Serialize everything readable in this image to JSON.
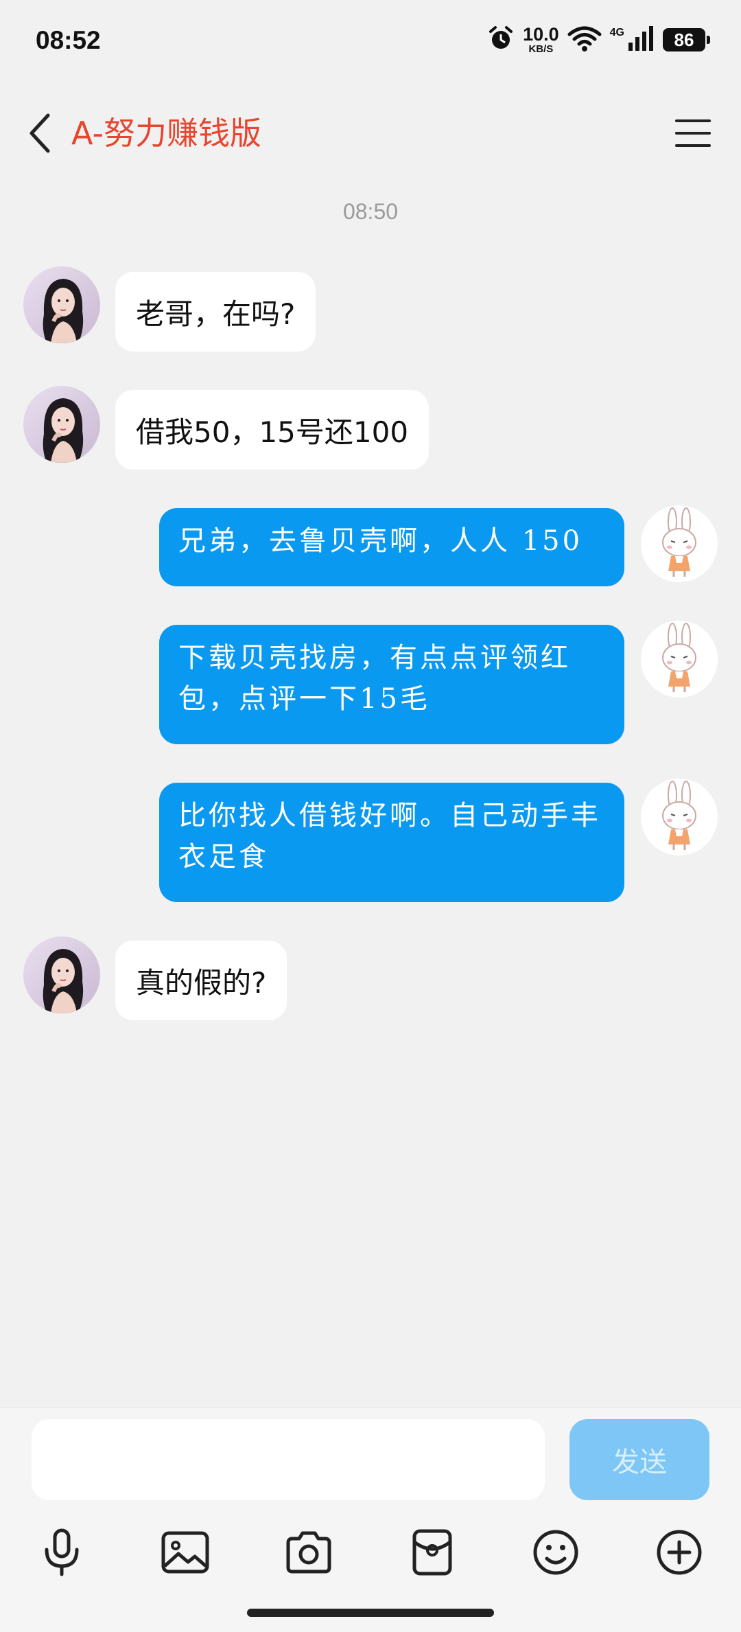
{
  "status_bar": {
    "time": "08:52",
    "net_speed_value": "10.0",
    "net_speed_unit": "KB/S",
    "network_type": "4G",
    "battery": "86",
    "icons": [
      "alarm-icon",
      "wifi-icon",
      "signal-icon",
      "battery-icon"
    ]
  },
  "header": {
    "title": "A-努力赚钱版",
    "title_color": "#e8452e",
    "back_icon": "chevron-left-icon",
    "menu_icon": "menu-icon"
  },
  "chat": {
    "timestamp": "08:50",
    "messages": [
      {
        "side": "in",
        "text": "老哥，在吗?"
      },
      {
        "side": "in",
        "text": "借我50，15号还100"
      },
      {
        "side": "out",
        "text": "兄弟，去鲁贝壳啊，人人 150"
      },
      {
        "side": "out",
        "text": "下载贝壳找房，有点点评领红包，点评一下15毛"
      },
      {
        "side": "out",
        "text": "比你找人借钱好啊。自己动手丰衣足食"
      },
      {
        "side": "in",
        "text": "真的假的?"
      }
    ],
    "outgoing_bubble_color": "#0a99f0",
    "incoming_bubble_color": "#ffffff"
  },
  "composer": {
    "input_value": "",
    "send_label": "发送",
    "tools": [
      "microphone-icon",
      "image-icon",
      "camera-icon",
      "red-packet-icon",
      "emoji-icon",
      "plus-icon"
    ]
  }
}
